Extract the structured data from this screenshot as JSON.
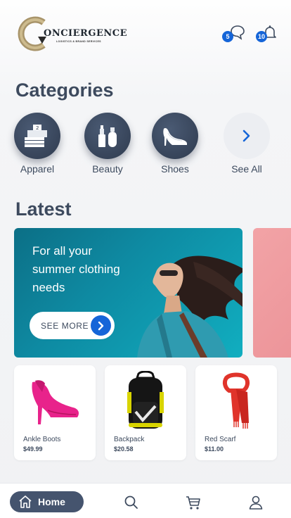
{
  "header": {
    "logo_text": "ONCIERGENCE",
    "logo_subtext": "LOGISTICS & BRAND SERVICES",
    "messages_icon": "chat-bubble-icon",
    "messages_badge": "5",
    "notifications_icon": "bell-icon",
    "notifications_badge": "10"
  },
  "categories": {
    "title": "Categories",
    "items": [
      {
        "label": "Apparel",
        "icon": "folded-shirt-icon"
      },
      {
        "label": "Beauty",
        "icon": "cosmetics-icon"
      },
      {
        "label": "Shoes",
        "icon": "high-heel-icon"
      },
      {
        "label": "See All",
        "icon": "chevron-right-icon"
      }
    ]
  },
  "latest": {
    "title": "Latest",
    "banner": {
      "text": "For all your summer clothing needs",
      "button_label": "SEE MORE",
      "button_icon": "chevron-right-icon"
    }
  },
  "products": [
    {
      "name": "Ankle Boots",
      "price": "$49.99"
    },
    {
      "name": "Backpack",
      "price": "$20.58"
    },
    {
      "name": "Red Scarf",
      "price": "$11.00"
    }
  ],
  "tabbar": {
    "home_label": "Home",
    "icons": [
      "home-icon",
      "search-icon",
      "cart-icon",
      "user-icon"
    ]
  },
  "colors": {
    "primary_dark": "#45546e",
    "accent_blue": "#1565d8",
    "banner_teal": "#0e8aa2"
  }
}
